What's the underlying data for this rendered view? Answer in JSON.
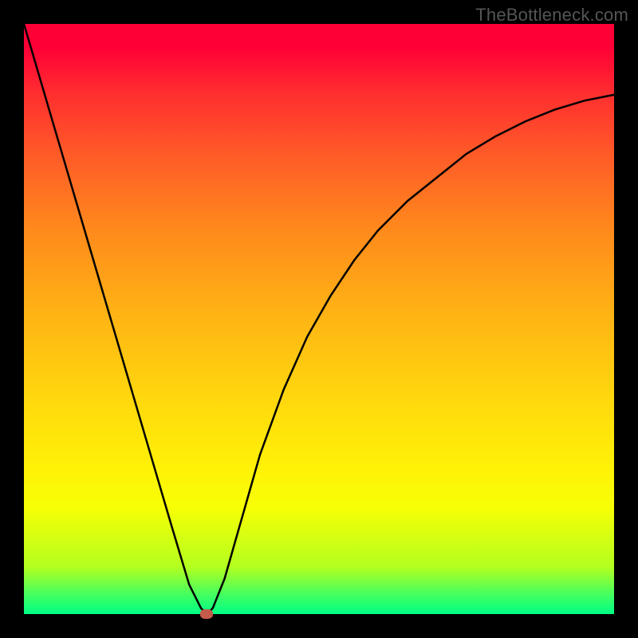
{
  "watermark": "TheBottleneck.com",
  "chart_data": {
    "type": "line",
    "title": "",
    "xlabel": "",
    "ylabel": "",
    "xlim": [
      0,
      100
    ],
    "ylim": [
      0,
      100
    ],
    "series": [
      {
        "name": "curve",
        "x": [
          0,
          5,
          10,
          15,
          20,
          25,
          28,
          30,
          31,
          32,
          34,
          36,
          38,
          40,
          44,
          48,
          52,
          56,
          60,
          65,
          70,
          75,
          80,
          85,
          90,
          95,
          100
        ],
        "values": [
          100,
          83,
          66,
          49,
          32,
          15,
          5,
          1,
          0,
          1,
          6,
          13,
          20,
          27,
          38,
          47,
          54,
          60,
          65,
          70,
          74,
          78,
          81,
          83.5,
          85.5,
          87,
          88
        ]
      }
    ],
    "marker": {
      "x": 31,
      "y": 0
    },
    "background_gradient": {
      "top": "#ff0036",
      "mid": "#ffd40e",
      "bottom": "#00ff84"
    }
  }
}
